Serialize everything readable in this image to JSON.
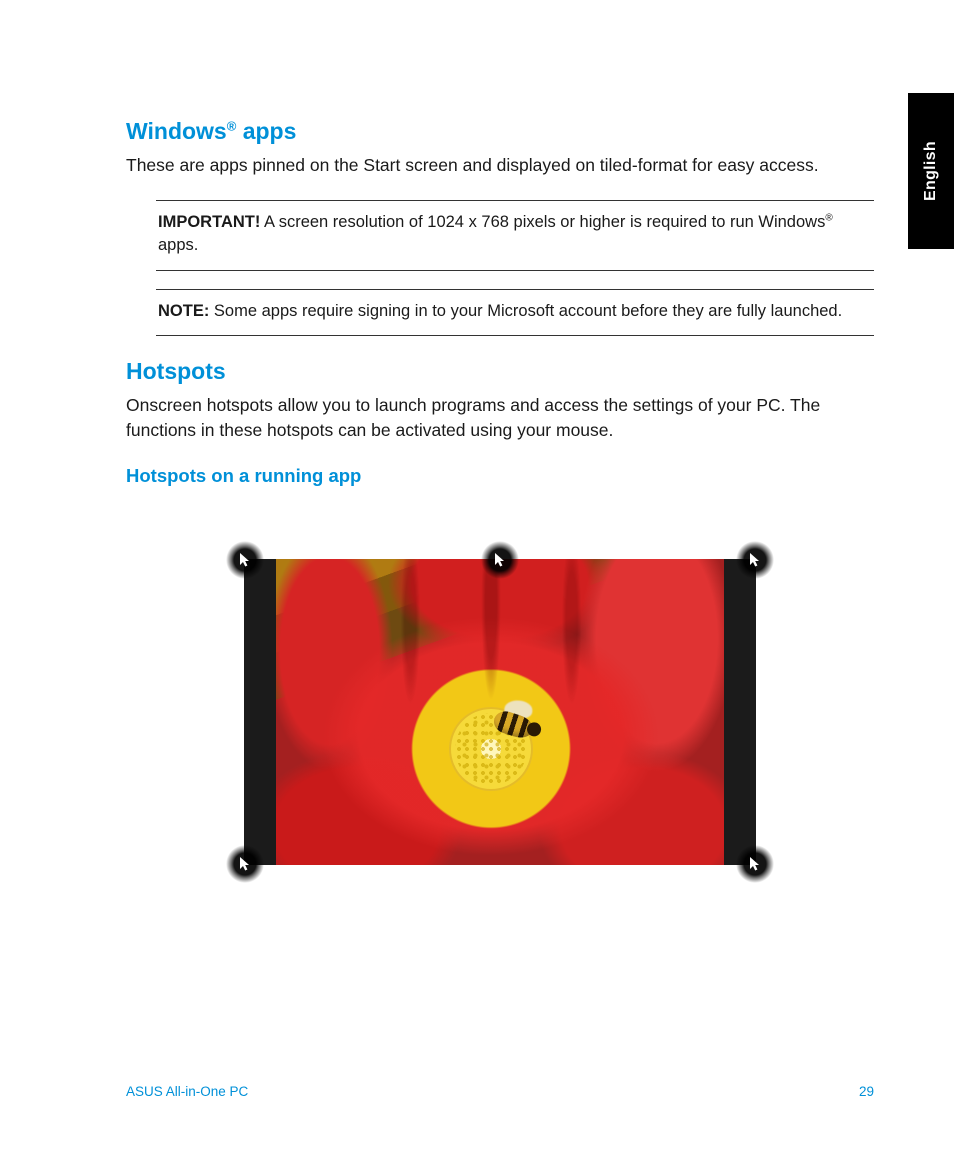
{
  "lang_tab": "English",
  "section1": {
    "heading_pre": "Windows",
    "heading_reg": "®",
    "heading_post": " apps",
    "body": "These are apps pinned on the Start screen and displayed on tiled-format for easy access."
  },
  "important_box": {
    "label": "IMPORTANT!",
    "text_pre": "   A screen resolution of 1024 x 768 pixels or higher is required to run Windows",
    "reg": "®",
    "text_post": " apps."
  },
  "note_box": {
    "label": "NOTE:",
    "text": "    Some apps require signing in to your Microsoft account before they are fully launched."
  },
  "section2": {
    "heading": "Hotspots",
    "body": "Onscreen hotspots allow you to launch programs and access the settings of your PC. The functions in these hotspots can be activated using your mouse.",
    "subheading": "Hotspots on a running app"
  },
  "footer": {
    "left": "ASUS All-in-One PC",
    "right": "29"
  }
}
